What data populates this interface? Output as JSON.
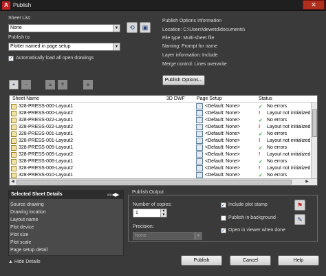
{
  "window": {
    "title": "Publish",
    "app_logo": "A",
    "close_glyph": "✕"
  },
  "sheet_list": {
    "label": "Sheet List:",
    "value": "None",
    "save_icon": "save-sheet-list-icon",
    "load_icon": "load-sheet-list-icon"
  },
  "publish_to": {
    "label": "Publish to:",
    "value": "Plotter named in page setup"
  },
  "auto_load": {
    "label": "Automatically load all open drawings",
    "checked": true
  },
  "options_info": {
    "title": "Publish Options Information",
    "location": "Location: C:\\Users\\dewetd\\documents\\",
    "file_type": "File type: Multi-sheet file",
    "naming": "Naming: Prompt for name",
    "layer_info": "Layer information: Include",
    "merge": "Merge control: Lines overwrite",
    "button": "Publish Options..."
  },
  "list": {
    "columns": [
      "Sheet Name",
      "3D DWF",
      "Page Setup",
      "Status"
    ],
    "rows": [
      {
        "name": "328-PRESS-000-Layout1",
        "setup": "<Default: None>",
        "status": "No errors",
        "ok": true
      },
      {
        "name": "328-PRESS-000-Layout2",
        "setup": "<Default: None>",
        "status": "Layout not initialized",
        "ok": false
      },
      {
        "name": "328-PRESS-022-Layout1",
        "setup": "<Default: None>",
        "status": "No errors",
        "ok": true
      },
      {
        "name": "328-PRESS-022-Layout2",
        "setup": "<Default: None>",
        "status": "Layout not initialized",
        "ok": false
      },
      {
        "name": "328-PRESS-001-Layout1",
        "setup": "<Default: None>",
        "status": "No errors",
        "ok": true
      },
      {
        "name": "328-PRESS-001-Layout2",
        "setup": "<Default: None>",
        "status": "Layout not initialized",
        "ok": false
      },
      {
        "name": "328-PRESS-005-Layout1",
        "setup": "<Default: None>",
        "status": "No errors",
        "ok": true
      },
      {
        "name": "328-PRESS-005-Layout2",
        "setup": "<Default: None>",
        "status": "Layout not initialized",
        "ok": false
      },
      {
        "name": "328-PRESS-006-Layout1",
        "setup": "<Default: None>",
        "status": "No errors",
        "ok": true
      },
      {
        "name": "328-PRESS-006-Layout2",
        "setup": "<Default: None>",
        "status": "Layout not initialized",
        "ok": false
      },
      {
        "name": "328-PRESS-010-Layout1",
        "setup": "<Default: None>",
        "status": "No errors",
        "ok": true
      }
    ]
  },
  "details": {
    "title": "Selected Sheet Details",
    "fields": [
      "Source drawing",
      "Drawing location",
      "Layout name",
      "Plot device",
      "Plot size",
      "Plot scale",
      "Page setup detail"
    ],
    "hide": "Hide Details"
  },
  "output": {
    "title": "Publish Output",
    "copies_label": "Number of copies:",
    "copies_value": "1",
    "precision_label": "Precision:",
    "precision_value": "None",
    "include_stamp": {
      "label": "Include plot stamp",
      "checked": true
    },
    "background": {
      "label": "Publish in background",
      "checked": false
    },
    "open_viewer": {
      "label": "Open in viewer when done",
      "checked": true
    }
  },
  "buttons": {
    "publish": "Publish",
    "cancel": "Cancel",
    "help": "Help"
  },
  "colors": {
    "ok": "#20a020",
    "error": "#d02020",
    "panel": "#3a3a3a"
  }
}
